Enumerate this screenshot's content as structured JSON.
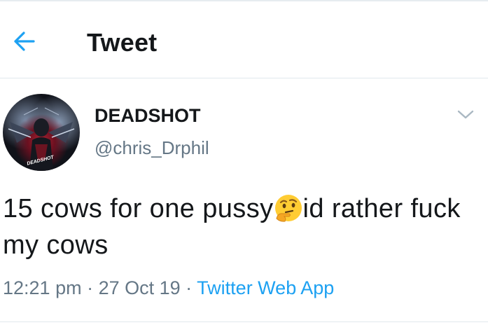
{
  "header": {
    "title": "Tweet",
    "back_icon": "arrow-left-icon",
    "accent": "#1da1f2"
  },
  "tweet": {
    "author_name": "DEADSHOT",
    "author_handle": "@chris_Drphil",
    "avatar_tag": "DEADSHOT",
    "text_before": "15 cows for one pussy",
    "emoji": "thinking-face-icon",
    "text_after": "id rather fuck my cows",
    "time": "12:21 pm",
    "sep": " · ",
    "date": "27 Oct 19",
    "source": "Twitter Web App",
    "menu_icon": "chevron-down-icon"
  }
}
